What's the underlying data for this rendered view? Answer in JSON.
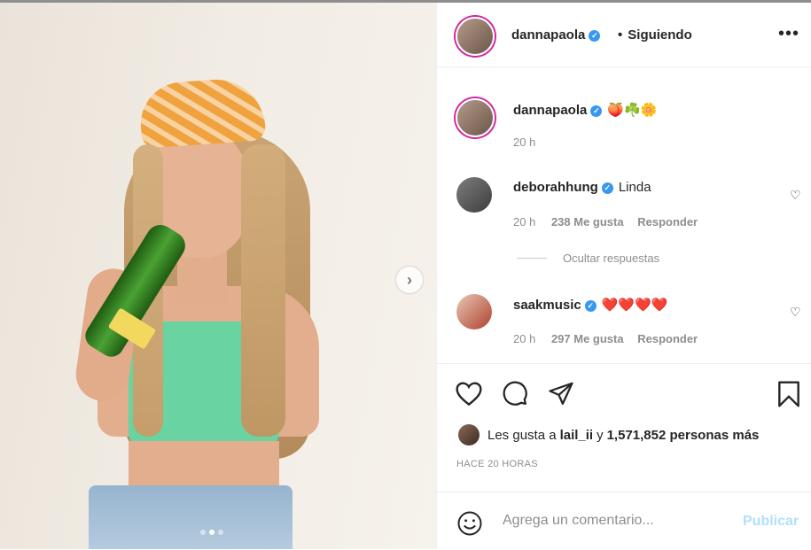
{
  "post": {
    "author": "dannapaola",
    "status": "Siguiendo",
    "separator": "•",
    "more_icon": "more-icon",
    "caption": "🍑☘️🌼",
    "caption_time": "20 h"
  },
  "comments": [
    {
      "user": "deborahhung",
      "text": "Linda",
      "time": "20 h",
      "likes": "238 Me gusta",
      "reply": "Responder"
    },
    {
      "user": "saakmusic",
      "text": "❤️❤️❤️❤️",
      "time": "20 h",
      "likes": "297 Me gusta",
      "reply": "Responder"
    }
  ],
  "hide_replies": "Ocultar respuestas",
  "likes": {
    "prefix": "Les gusta a",
    "user": "lail_ii",
    "connector": "y",
    "count": "1,571,852 personas más"
  },
  "timestamp": "HACE 20 HORAS",
  "comment_box": {
    "placeholder": "Agrega un comentario...",
    "publish": "Publicar"
  },
  "carousel": {
    "total": 3,
    "active_index": 1
  },
  "colors": {
    "accent": "#3897f0",
    "publish_disabled": "#b2dffc",
    "story_ring": "#d6249f"
  }
}
